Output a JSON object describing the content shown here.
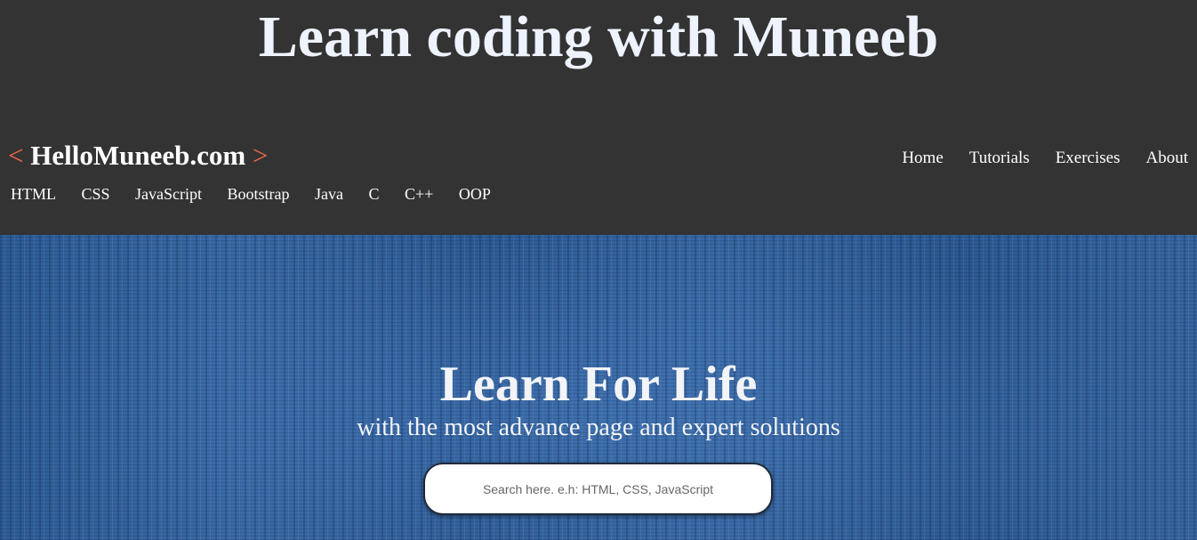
{
  "header": {
    "site_title": "Learn coding with Muneeb",
    "brand": {
      "open_bracket": "<",
      "name": "HelloMuneeb.com",
      "close_bracket": ">"
    },
    "main_nav": [
      "Home",
      "Tutorials",
      "Exercises",
      "About"
    ],
    "topic_nav": [
      "HTML",
      "CSS",
      "JavaScript",
      "Bootstrap",
      "Java",
      "C",
      "C++",
      "OOP"
    ]
  },
  "hero": {
    "title": "Learn For Life",
    "subtitle": "with the most advance page and expert solutions",
    "search": {
      "placeholder": "Search here. e.h: HTML, CSS, JavaScript",
      "value": ""
    }
  },
  "colors": {
    "header_bg": "#333333",
    "accent": "#ef6a4b",
    "hero_bg": "#3a6aa3",
    "title_text": "#eef3ff"
  }
}
